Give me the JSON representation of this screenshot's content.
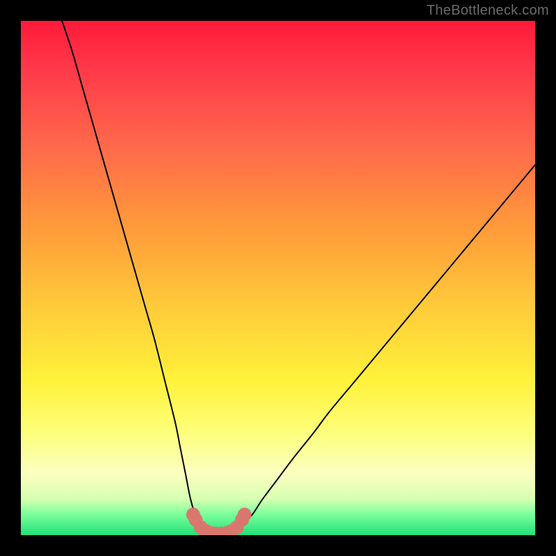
{
  "watermark": "TheBottleneck.com",
  "chart_data": {
    "type": "line",
    "title": "",
    "xlabel": "",
    "ylabel": "",
    "xlim": [
      0,
      100
    ],
    "ylim": [
      0,
      100
    ],
    "grid": false,
    "legend": false,
    "annotations": [],
    "series": [
      {
        "name": "bottleneck-curve",
        "color": "#000000",
        "stroke_width": 2,
        "x": [
          8,
          10,
          12,
          14,
          16,
          18,
          20,
          22,
          24,
          26,
          28,
          30,
          31,
          32,
          33,
          34,
          36,
          37,
          38,
          39,
          41,
          42,
          43,
          45,
          47,
          50,
          53,
          57,
          60,
          65,
          70,
          75,
          80,
          85,
          90,
          95,
          100
        ],
        "y": [
          100,
          94,
          87,
          80,
          73,
          66,
          59,
          52,
          45,
          38,
          30,
          22,
          17,
          12,
          7,
          4,
          1,
          0,
          0,
          0,
          0,
          1,
          2,
          4,
          7,
          11,
          15,
          20,
          24,
          30,
          36,
          42,
          48,
          54,
          60,
          66,
          72
        ]
      },
      {
        "name": "bottom-markers",
        "color": "#d9776f",
        "type": "scatter",
        "marker_size": 10,
        "x": [
          33.5,
          34,
          35,
          36,
          37,
          38,
          39,
          40,
          41,
          42,
          43,
          43.5
        ],
        "y": [
          4,
          3,
          1.5,
          0.8,
          0.4,
          0.3,
          0.3,
          0.4,
          0.8,
          1.5,
          3,
          4
        ]
      }
    ]
  }
}
